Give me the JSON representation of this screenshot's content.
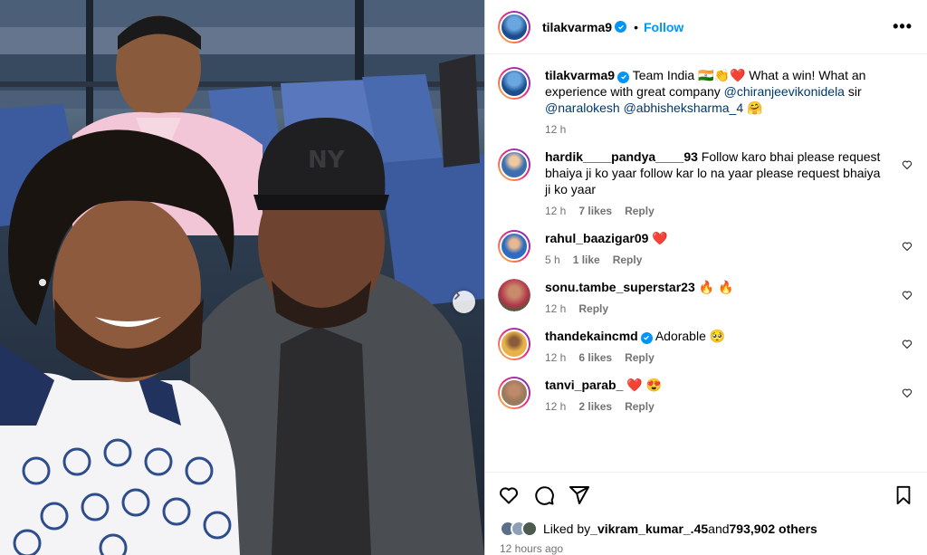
{
  "post": {
    "author": "tilakvarma9",
    "follow_label": "Follow",
    "dot": "•",
    "more": "•••",
    "caption": {
      "username": "tilakvarma9",
      "text_1": "Team India ",
      "text_flag": "🇮🇳👏❤️",
      "text_2": " What a win! What an experience with great company ",
      "mention_1": "@chiranjeevikonidela",
      "text_3": " sir ",
      "mention_2": "@naralokesh",
      "text_4": " ",
      "mention_3": "@abhisheksharma_4",
      "text_5": " 🤗",
      "time": "12 h"
    },
    "likes_prefix": "Liked by ",
    "liked_by_user": "_vikram_kumar_.45",
    "likes_and": " and ",
    "likes_count": "793,902 others",
    "posted_ago": "12 hours ago"
  },
  "comments": [
    {
      "username": "hardik____pandya____93",
      "text": "Follow karo bhai please request bhaiya ji ko yaar follow kar lo na yaar please request bhaiya ji ko yaar",
      "time": "12 h",
      "likes": "7 likes",
      "reply": "Reply",
      "avatar_color": "#3b6fb0"
    },
    {
      "username": "rahul_baazigar09",
      "text": "❤️",
      "time": "5 h",
      "likes": "1 like",
      "reply": "Reply",
      "avatar_color": "#2d6cc0"
    },
    {
      "username": "sonu.tambe_superstar23",
      "text": "🔥 🔥",
      "time": "12 h",
      "likes": "",
      "reply": "Reply",
      "avatar_color": "#b0344a"
    },
    {
      "username": "thandekaincmd",
      "verified": true,
      "text": "Adorable 🥺",
      "time": "12 h",
      "likes": "6 likes",
      "reply": "Reply",
      "avatar_color": "#e7b24a"
    },
    {
      "username": "tanvi_parab_",
      "text": "❤️ 😍",
      "time": "12 h",
      "likes": "2 likes",
      "reply": "Reply",
      "avatar_color": "#9a7a5c"
    }
  ],
  "icons": {
    "like": "heart-icon",
    "comment": "comment-icon",
    "share": "share-icon",
    "save": "bookmark-icon",
    "next": "chevron-right-icon"
  },
  "colors": {
    "accent": "#0095f6",
    "mention": "#00376b",
    "muted": "#737373"
  }
}
